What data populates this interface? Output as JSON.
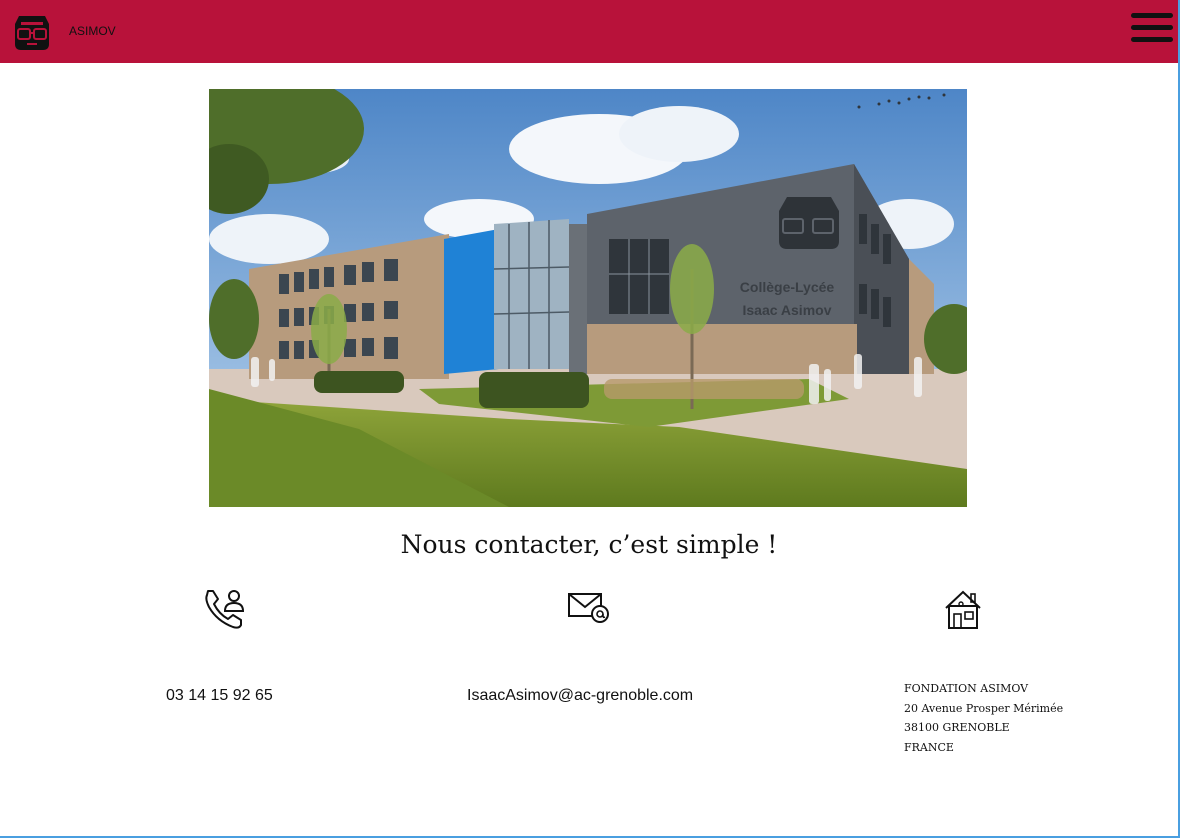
{
  "header": {
    "brand": "ASIMOV"
  },
  "hero": {
    "building_lines": [
      "Collège-Lycée",
      "Isaac Asimov"
    ]
  },
  "contact": {
    "title": "Nous contacter, c’est simple !",
    "phone": "03 14 15 92 65",
    "email": "IsaacAsimov@ac-grenoble.com",
    "address": [
      "FONDATION ASIMOV",
      "20 Avenue Prosper Mérimée",
      "38100 GRENOBLE",
      "FRANCE"
    ]
  },
  "colors": {
    "header": "#b8123a",
    "frame": "#4a9fe0"
  },
  "icons": [
    "mascot-logo-icon",
    "hamburger-menu-icon",
    "phone-icon",
    "mail-icon",
    "house-icon"
  ]
}
